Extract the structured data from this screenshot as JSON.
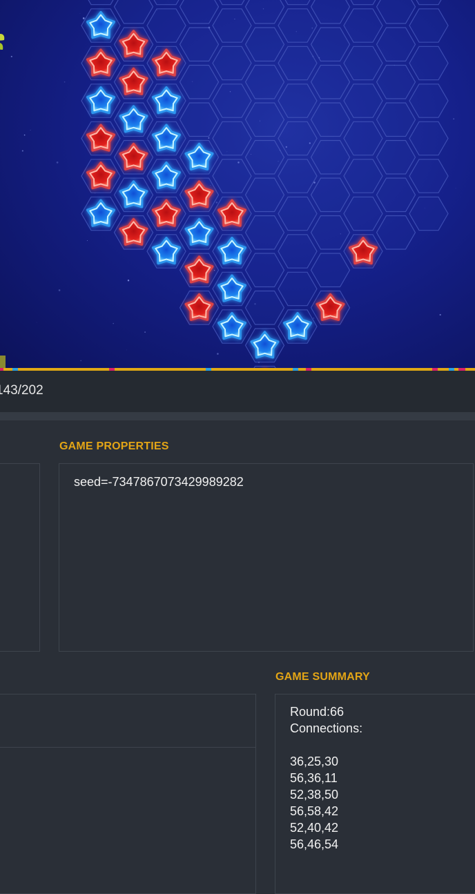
{
  "frame": {
    "counter": "143/202"
  },
  "game_properties": {
    "heading": "GAME PROPERTIES",
    "seed": "seed=-7347867073429989282"
  },
  "game_summary": {
    "heading": "GAME SUMMARY",
    "round": "Round:66",
    "connections_label": "Connections:",
    "connections": [
      "36,25,30",
      "56,36,11",
      "52,38,50",
      "56,58,42",
      "52,40,42",
      "56,46,54"
    ]
  },
  "colors": {
    "accent": "#e3a516",
    "board_bg": "#15208a",
    "red_star": "#ff4a3a",
    "blue_star": "#33aaff",
    "hex_outline": "#4a5cc0"
  },
  "board": {
    "pieces": [
      {
        "col": 0,
        "row": 0,
        "color": "blue"
      },
      {
        "col": 0,
        "row": 1,
        "color": "red"
      },
      {
        "col": 0,
        "row": 2,
        "color": "blue"
      },
      {
        "col": 0,
        "row": 3,
        "color": "red"
      },
      {
        "col": 0,
        "row": 4,
        "color": "red"
      },
      {
        "col": 0,
        "row": 5,
        "color": "blue"
      },
      {
        "col": 1,
        "row": 0,
        "color": "red"
      },
      {
        "col": 1,
        "row": 1,
        "color": "red"
      },
      {
        "col": 1,
        "row": 2,
        "color": "blue"
      },
      {
        "col": 1,
        "row": 3,
        "color": "red"
      },
      {
        "col": 1,
        "row": 4,
        "color": "blue"
      },
      {
        "col": 1,
        "row": 5,
        "color": "red"
      },
      {
        "col": 2,
        "row": 1,
        "color": "red"
      },
      {
        "col": 2,
        "row": 2,
        "color": "blue"
      },
      {
        "col": 2,
        "row": 3,
        "color": "blue"
      },
      {
        "col": 2,
        "row": 4,
        "color": "blue"
      },
      {
        "col": 2,
        "row": 5,
        "color": "red"
      },
      {
        "col": 2,
        "row": 6,
        "color": "blue"
      },
      {
        "col": 3,
        "row": 3,
        "color": "blue"
      },
      {
        "col": 3,
        "row": 4,
        "color": "red"
      },
      {
        "col": 3,
        "row": 5,
        "color": "blue"
      },
      {
        "col": 3,
        "row": 6,
        "color": "red"
      },
      {
        "col": 3,
        "row": 7,
        "color": "red"
      },
      {
        "col": 4,
        "row": 5,
        "color": "red"
      },
      {
        "col": 4,
        "row": 6,
        "color": "blue"
      },
      {
        "col": 4,
        "row": 7,
        "color": "blue"
      },
      {
        "col": 4,
        "row": 8,
        "color": "blue"
      },
      {
        "col": 5,
        "row": 8,
        "color": "blue"
      },
      {
        "col": 5,
        "row": 9,
        "color": "red"
      },
      {
        "col": 6,
        "row": 8,
        "color": "blue"
      },
      {
        "col": 7,
        "row": 7,
        "color": "red"
      },
      {
        "col": 8,
        "row": 6,
        "color": "red"
      }
    ]
  }
}
